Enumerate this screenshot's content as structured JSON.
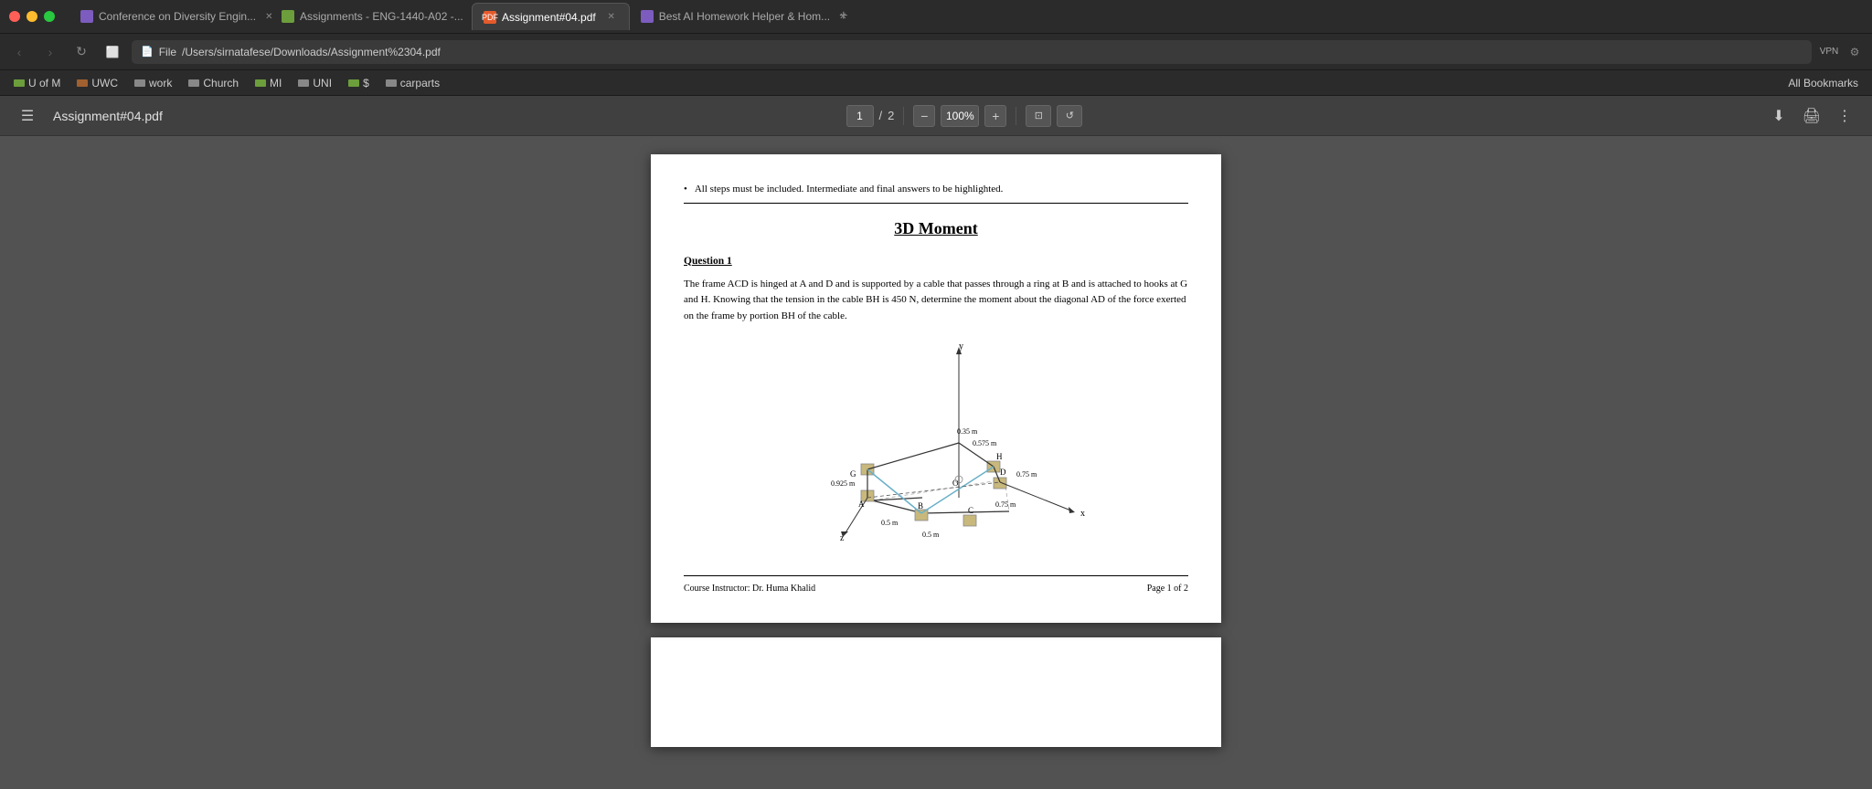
{
  "window": {
    "controls": {
      "red_label": "●",
      "yellow_label": "●",
      "green_label": "●"
    }
  },
  "tabs": [
    {
      "id": "tab1",
      "label": "Conference on Diversity Engin...",
      "favicon_color": "#7c5cbf",
      "active": false,
      "closable": true
    },
    {
      "id": "tab2",
      "label": "Assignments - ENG-1440-A02 -...",
      "favicon_color": "#6c9e3c",
      "active": false,
      "closable": true
    },
    {
      "id": "tab3",
      "label": "Assignment#04.pdf",
      "favicon_color": "#e55a2b",
      "active": true,
      "closable": true
    },
    {
      "id": "tab4",
      "label": "Best AI Homework Helper & Hom...",
      "favicon_color": "#7c5cbf",
      "active": false,
      "closable": true
    }
  ],
  "navbar": {
    "address": "/Users/sirnatafese/Downloads/Assignment%2304.pdf",
    "address_prefix": "File"
  },
  "bookmarks": [
    {
      "id": "bm1",
      "label": "U of M",
      "color": "#6c9e3c"
    },
    {
      "id": "bm2",
      "label": "UWC",
      "color": "#a06030"
    },
    {
      "id": "bm3",
      "label": "work",
      "color": "#888"
    },
    {
      "id": "bm4",
      "label": "Church",
      "color": "#888"
    },
    {
      "id": "bm5",
      "label": "MI",
      "color": "#6c9e3c"
    },
    {
      "id": "bm6",
      "label": "UNI",
      "color": "#888"
    },
    {
      "id": "bm7",
      "label": "$",
      "color": "#6c9e3c"
    },
    {
      "id": "bm8",
      "label": "carparts",
      "color": "#888"
    },
    {
      "id": "bm9",
      "label": "All Bookmarks",
      "color": ""
    }
  ],
  "pdf_toolbar": {
    "title": "Assignment#04.pdf",
    "menu_icon": "☰",
    "current_page": "1",
    "total_pages": "2",
    "zoom_value": "100%",
    "zoom_minus": "−",
    "zoom_plus": "+",
    "download_icon": "⬇",
    "print_icon": "🖨",
    "more_icon": "⋮"
  },
  "pdf_content": {
    "bullet_text": "All steps must be included. Intermediate and final answers to be highlighted.",
    "main_title": "3D Moment",
    "question1_title": "Question 1",
    "question1_body": "The frame ACD is hinged at A and D and is supported by a cable that passes through a ring at B and is attached to hooks at G and H. Knowing that the tension in the cable BH is 450 N, determine the moment about the diagonal AD of the force exerted on the frame by portion BH of the cable.",
    "footer_instructor": "Course Instructor: Dr. Huma Khalid",
    "footer_page": "Page 1 of 2",
    "diagram": {
      "label_y": "y",
      "label_z": "z",
      "label_x": "x",
      "dim_035": "0.35 m",
      "dim_0575": "0.575 m",
      "dim_0925": "0.925 m",
      "dim_075_right": "0.75 m",
      "dim_075_bottom": "0.75 m",
      "dim_05_left": "0.5 m",
      "dim_05_bottom": "0.5 m",
      "point_G": "G",
      "point_H": "H",
      "point_O": "O",
      "point_A": "A",
      "point_B": "B",
      "point_C": "C",
      "point_D": "D"
    }
  }
}
